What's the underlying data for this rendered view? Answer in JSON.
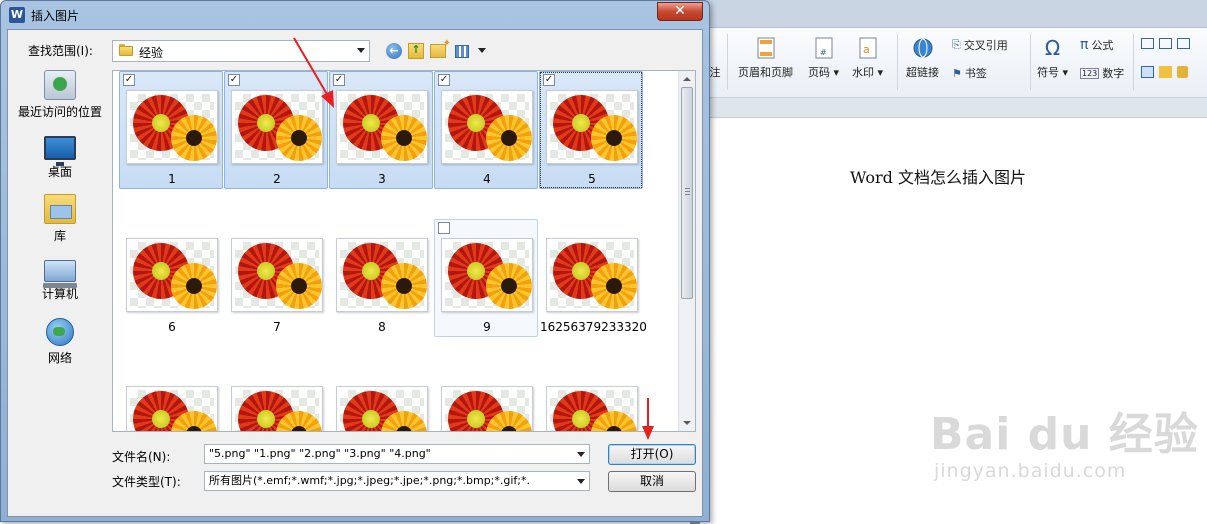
{
  "dialog": {
    "title": "插入图片",
    "close_glyph": "✕",
    "look_in_label": "查找范围(I):",
    "look_in_value": "经验",
    "places": [
      {
        "label": "最近访问的位置",
        "icon": "recent-places-icon"
      },
      {
        "label": "桌面",
        "icon": "desktop-icon"
      },
      {
        "label": "库",
        "icon": "library-icon"
      },
      {
        "label": "计算机",
        "icon": "computer-icon"
      },
      {
        "label": "网络",
        "icon": "network-icon"
      }
    ],
    "files": [
      {
        "name": "1",
        "checked": true,
        "selected": true
      },
      {
        "name": "2",
        "checked": true,
        "selected": true
      },
      {
        "name": "3",
        "checked": true,
        "selected": true
      },
      {
        "name": "4",
        "checked": true,
        "selected": true
      },
      {
        "name": "5",
        "checked": true,
        "selected": true,
        "focused": true
      },
      {
        "name": "6",
        "checked": false,
        "selected": false
      },
      {
        "name": "7",
        "checked": false,
        "selected": false
      },
      {
        "name": "8",
        "checked": false,
        "selected": false
      },
      {
        "name": "9",
        "checked": false,
        "selected": false,
        "hovered": true
      },
      {
        "name": "16256379233320",
        "checked": false,
        "selected": false
      },
      {
        "name": "",
        "checked": false,
        "selected": false
      },
      {
        "name": "",
        "checked": false,
        "selected": false
      },
      {
        "name": "",
        "checked": false,
        "selected": false
      },
      {
        "name": "",
        "checked": false,
        "selected": false
      },
      {
        "name": "",
        "checked": false,
        "selected": false
      }
    ],
    "file_name_label": "文件名(N):",
    "file_name_value": "\"5.png\" \"1.png\" \"2.png\" \"3.png\" \"4.png\"",
    "file_type_label": "文件类型(T):",
    "file_type_value": "所有图片(*.emf;*.wmf;*.jpg;*.jpeg;*.jpe;*.png;*.bmp;*.gif;*.",
    "open_button": "打开(O)",
    "cancel_button": "取消"
  },
  "background": {
    "ribbon": {
      "header_footer": "页眉和页脚",
      "page_number": "页码",
      "watermark": "水印",
      "hyperlink": "超链接",
      "cross_reference": "交叉引用",
      "bookmark": "书签",
      "symbol": "符号",
      "formula": "公式",
      "number": "数字",
      "partial_left": "注"
    },
    "document_text": "Word 文档怎么插入图片",
    "watermark_main": "Bai du 经验",
    "watermark_sub": "jingyan.baidu.com"
  },
  "colors": {
    "selection": "#c7dcf4",
    "annotation_arrow": "#e81f1f",
    "close_button": "#c64a32"
  }
}
